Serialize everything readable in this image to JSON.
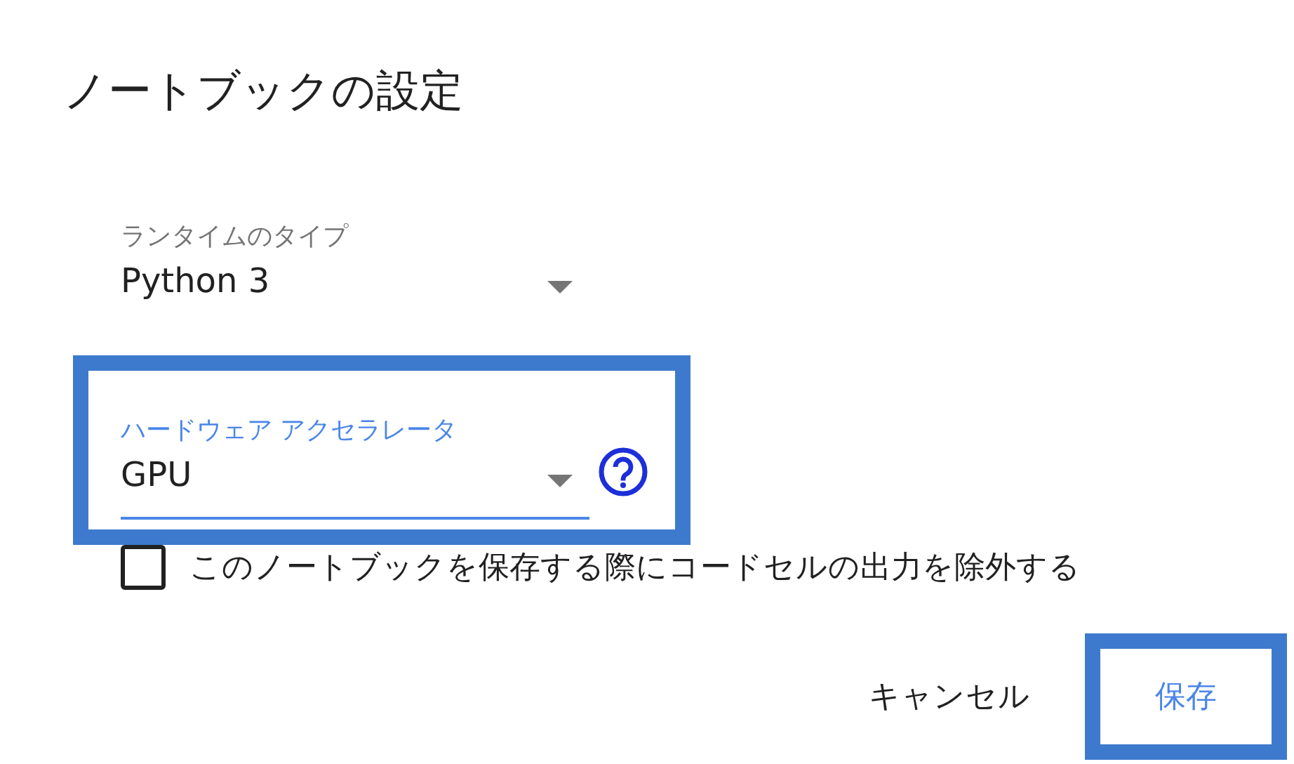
{
  "dialog": {
    "title": "ノートブックの設定"
  },
  "fields": [
    {
      "label": "ランタイムのタイプ",
      "value": "Python 3",
      "focused": false,
      "highlighted": false,
      "help": false
    },
    {
      "label": "ハードウェア アクセラレータ",
      "value": "GPU",
      "focused": true,
      "highlighted": true,
      "help": true
    }
  ],
  "checkbox": {
    "label": "このノートブックを保存する際にコードセルの出力を除外する",
    "checked": false
  },
  "buttons": [
    {
      "label": "キャンセル",
      "kind": "text",
      "highlighted": false
    },
    {
      "label": "保存",
      "kind": "primary",
      "highlighted": true
    }
  ]
}
